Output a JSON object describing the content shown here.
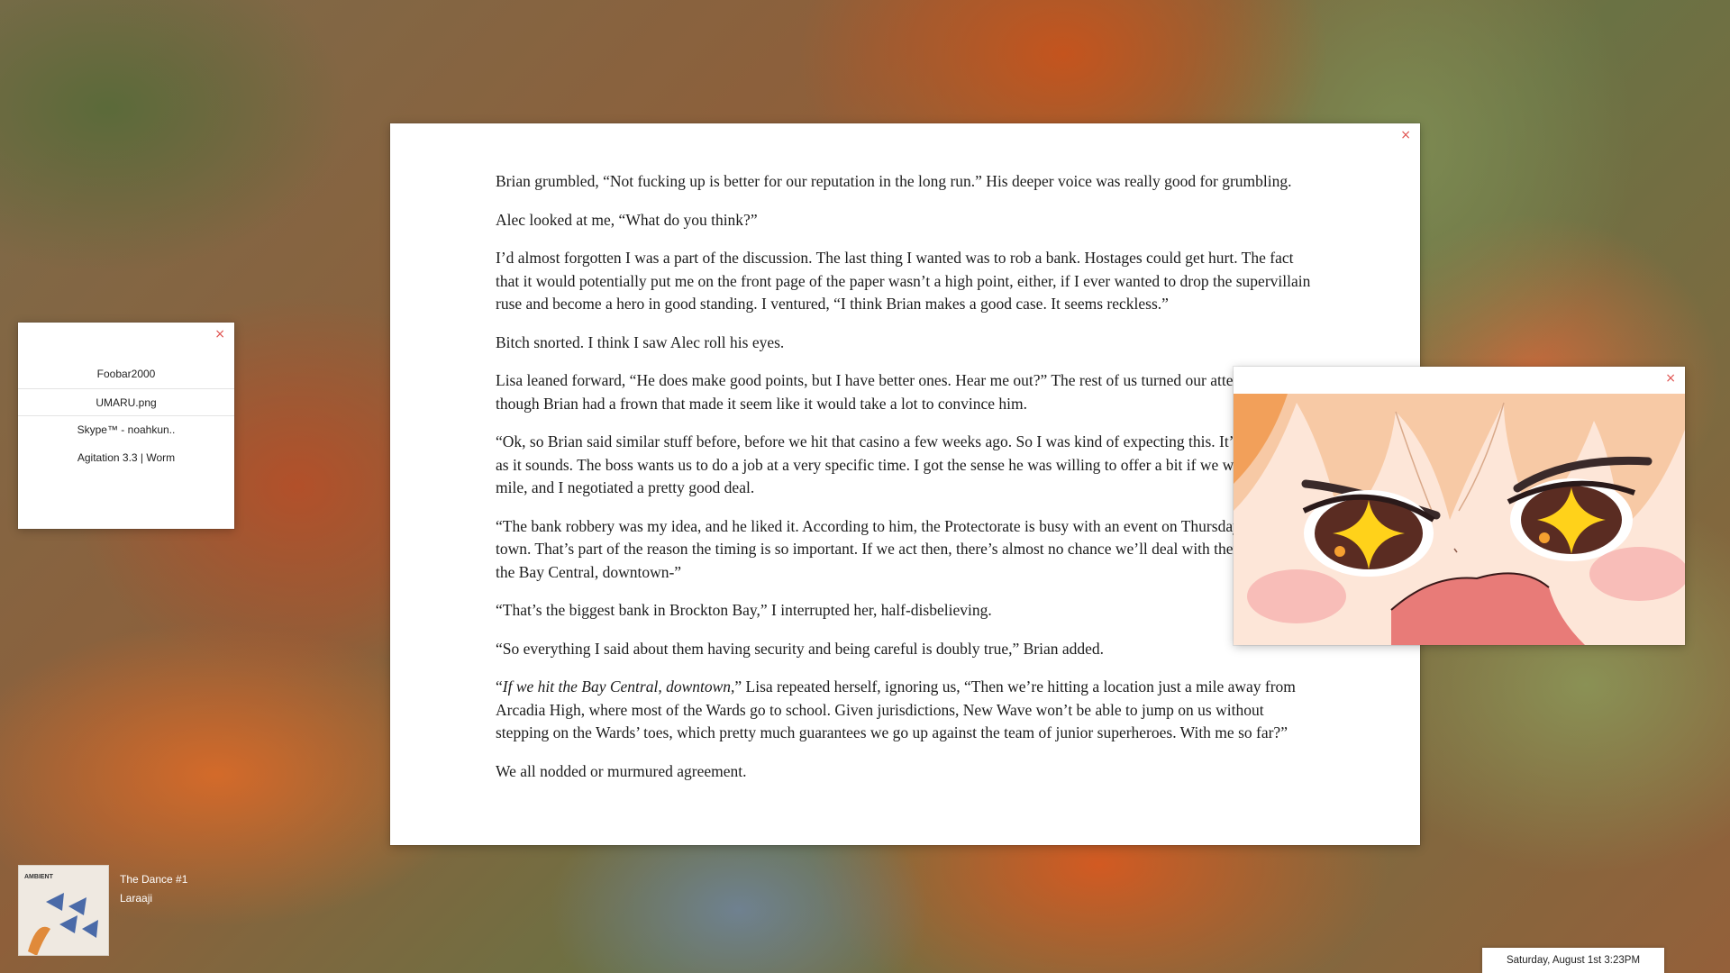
{
  "launcher": {
    "close_glyph": "×",
    "items": [
      {
        "label": "Foobar2000"
      },
      {
        "label": "UMARU.png"
      },
      {
        "label": "Skype™ - noahkun.."
      },
      {
        "label": "Agitation 3.3 | Worm"
      }
    ]
  },
  "reader": {
    "close_glyph": "×",
    "paragraphs": [
      "Brian grumbled, “Not fucking up is better for our reputation in the long run.”  His deeper voice was really good for grumbling.",
      "Alec looked at me, “What do you think?”",
      "I’d almost forgotten I was a part of the discussion.  The last thing I wanted was to rob a bank.  Hostages could get hurt.  The fact that it would potentially put me on the front page of the paper wasn’t a high point, either, if I ever wanted to drop the supervillain ruse and become a hero in good standing.  I ventured, “I think Brian makes a good case.  It seems reckless.”",
      "Bitch snorted.  I think I saw Alec roll his eyes.",
      "Lisa leaned forward, “He does make good points, but I have better ones.  Hear me out?”  The rest of us turned our attention to her, though Brian had a frown that made it seem like it would take a lot to convince him.",
      "“Ok, so Brian said similar stuff before, before we hit that casino a few weeks ago.  So I was kind of expecting this.  It’s not as bad as it sounds.  The boss wants us to do a job at a very specific time.  I got the sense he was willing to offer a bit if we went the extra mile, and I negotiated a pretty good deal.",
      "“The bank robbery was my idea, and he liked it.  According to him, the Protectorate is busy with an event on Thursday outside of town.  That’s part of the reason the timing is so important.  If we act then, there’s almost no chance we’ll deal with them.  If we hit the Bay Central, downtown-”",
      "“That’s the biggest bank in Brockton Bay,” I interrupted her, half-disbelieving.",
      "“So everything I said about them having security and being careful is doubly true,” Brian added.",
      "We all nodded or murmured agreement."
    ],
    "p10": {
      "italic": "If we hit the Bay Central, downtown,",
      "rest": "” Lisa repeated herself, ignoring us, “Then we’re hitting a location just a mile away from Arcadia High, where most of the Wards go to school.  Given jurisdictions, New Wave won’t be able to jump on us without stepping on the Wards’ toes, which pretty much guarantees we go up against the team of junior superheroes.  With me so far?”",
      "open_quote": "“"
    }
  },
  "viewer": {
    "close_glyph": "×"
  },
  "now_playing": {
    "title": "The Dance #1",
    "artist": "Laraaji",
    "cover_text": "AMBIENT"
  },
  "clock": {
    "text": "Saturday, August 1st  3:23PM"
  }
}
